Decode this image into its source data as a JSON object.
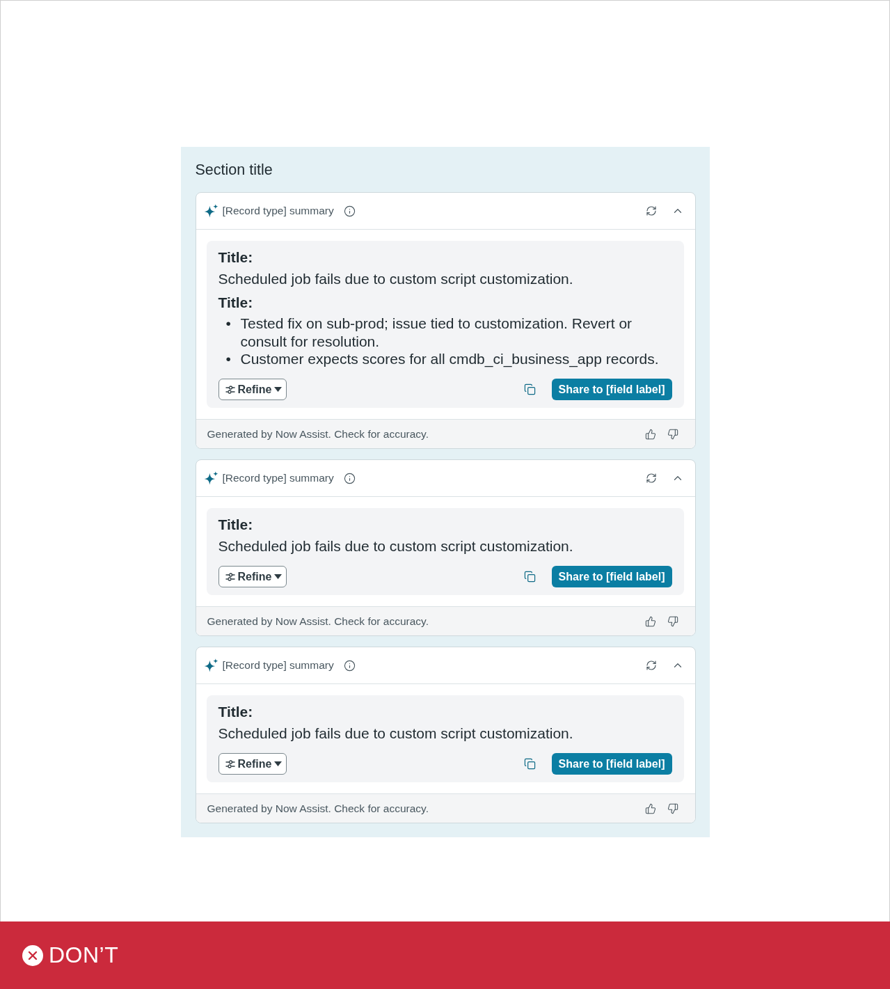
{
  "section_title": "Section title",
  "cards": [
    {
      "title": "[Record type] summary",
      "expanded": true,
      "content": [
        {
          "kind": "heading",
          "text": "Title:"
        },
        {
          "kind": "paragraph",
          "text": "Scheduled job fails due to custom script customization."
        },
        {
          "kind": "heading",
          "text": "Title:"
        },
        {
          "kind": "bullets",
          "items": [
            {
              "marker": "•",
              "text": "Tested fix on sub-prod; issue tied to customization. Revert or consult for resolution."
            },
            {
              "marker": "•",
              "text": "Customer expects scores for all cmdb_ci_business_app records."
            }
          ]
        }
      ],
      "refine_label": "Refine",
      "share_label": "Share to [field label]",
      "footer_note": "Generated by Now Assist. Check for accuracy."
    },
    {
      "title": "[Record type] summary",
      "expanded": true,
      "content": [
        {
          "kind": "heading",
          "text": "Title:"
        },
        {
          "kind": "paragraph",
          "text": "Scheduled job fails due to custom script customization."
        }
      ],
      "refine_label": "Refine",
      "share_label": "Share to [field label]",
      "footer_note": "Generated by Now Assist. Check for accuracy."
    },
    {
      "title": "[Record type] summary",
      "expanded": true,
      "content": [
        {
          "kind": "heading",
          "text": "Title:"
        },
        {
          "kind": "paragraph",
          "text": "Scheduled job fails due to custom script customization."
        }
      ],
      "refine_label": "Refine",
      "share_label": "Share to [field label]",
      "footer_note": "Generated by Now Assist. Check for accuracy."
    }
  ],
  "banner": {
    "label": "DON’T"
  }
}
